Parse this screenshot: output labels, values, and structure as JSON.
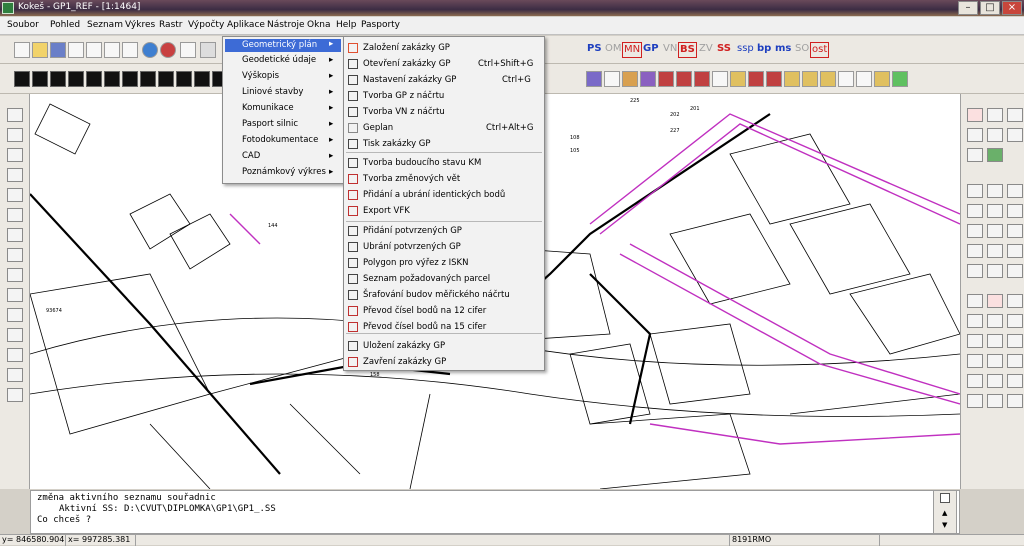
{
  "window": {
    "title": "Kokeš - GP1_REF - [1:1464]"
  },
  "menubar": [
    "Soubor",
    "Pohled",
    "Seznam",
    "Výkres",
    "Rastr",
    "Výpočty",
    "Aplikace",
    "Nástroje",
    "Okna",
    "Help",
    "Pasporty"
  ],
  "toolbar_ps": [
    {
      "label": "PS",
      "color": "#1e3fbf"
    },
    {
      "label": "OM",
      "color": "#a0a0a0"
    },
    {
      "label": "MN",
      "color": "#d02020"
    },
    {
      "label": "GP",
      "color": "#1e3fbf"
    },
    {
      "label": "VN",
      "color": "#a0a0a0"
    },
    {
      "label": "BS",
      "color": "#d02020"
    },
    {
      "label": "ZV",
      "color": "#a0a0a0"
    },
    {
      "label": "SS",
      "color": "#d02020"
    },
    {
      "label": "ssp",
      "color": "#1e3fbf"
    },
    {
      "label": "bp",
      "color": "#1e3fbf"
    },
    {
      "label": "ms",
      "color": "#1e3fbf"
    },
    {
      "label": "SO",
      "color": "#a0a0a0"
    },
    {
      "label": "ost",
      "color": "#d02020"
    }
  ],
  "aplikace_menu": [
    {
      "label": "Geometrický plán",
      "highlighted": true
    },
    {
      "label": "Geodetické údaje"
    },
    {
      "label": "Výškopis"
    },
    {
      "label": "Liniové stavby"
    },
    {
      "label": "Komunikace"
    },
    {
      "label": "Pasport silnic"
    },
    {
      "label": "Fotodokumentace"
    },
    {
      "label": "CAD"
    },
    {
      "label": "Poznámkový výkres"
    }
  ],
  "gp_submenu": [
    {
      "label": "Založení zakázky GP",
      "shortcut": "",
      "icon": "new-order-icon",
      "group": 1
    },
    {
      "label": "Otevření zakázky GP",
      "shortcut": "Ctrl+Shift+G",
      "icon": "open-order-icon",
      "group": 1
    },
    {
      "label": "Nastavení zakázky GP",
      "shortcut": "Ctrl+G",
      "icon": "settings-order-icon",
      "group": 1
    },
    {
      "label": "Tvorba GP z náčrtu",
      "shortcut": "",
      "icon": "sketch-icon",
      "group": 1
    },
    {
      "label": "Tvorba VN z náčrtu",
      "shortcut": "",
      "icon": "sketch-icon",
      "group": 1
    },
    {
      "label": "Geplan",
      "shortcut": "Ctrl+Alt+G",
      "icon": "geplan-icon",
      "group": 1
    },
    {
      "label": "Tisk zakázky GP",
      "shortcut": "",
      "icon": "print-icon",
      "group": 1
    },
    {
      "label": "Tvorba budoucího stavu KM",
      "shortcut": "",
      "icon": "map-icon",
      "group": 2
    },
    {
      "label": "Tvorba změnových vět",
      "shortcut": "",
      "icon": "change-icon",
      "group": 2
    },
    {
      "label": "Přidání a ubrání identických bodů",
      "shortcut": "",
      "icon": "points-icon",
      "group": 2
    },
    {
      "label": "Export VFK",
      "shortcut": "",
      "icon": "vfk-icon",
      "group": 2
    },
    {
      "label": "Přidání potvrzených GP",
      "shortcut": "",
      "icon": "add-doc-icon",
      "group": 3
    },
    {
      "label": "Ubrání potvrzených GP",
      "shortcut": "",
      "icon": "remove-doc-icon",
      "group": 3
    },
    {
      "label": "Polygon pro výřez z ISKN",
      "shortcut": "",
      "icon": "polygon-icon",
      "group": 3
    },
    {
      "label": "Seznam požadovaných parcel",
      "shortcut": "",
      "icon": "list-icon",
      "group": 3
    },
    {
      "label": "Šrafování budov měřického náčrtu",
      "shortcut": "",
      "icon": "hatch-icon",
      "group": 3
    },
    {
      "label": "Převod čísel bodů na 12 cifer",
      "shortcut": "",
      "icon": "convert12-icon",
      "group": 3
    },
    {
      "label": "Převod čísel bodů na 15 cifer",
      "shortcut": "",
      "icon": "convert15-icon",
      "group": 3
    },
    {
      "label": "Uložení zakázky GP",
      "shortcut": "",
      "icon": "save-icon",
      "group": 4
    },
    {
      "label": "Zavření zakázky GP",
      "shortcut": "",
      "icon": "close-order-icon",
      "group": 4
    }
  ],
  "command": {
    "line1": "změna aktivního seznamu souřadnic",
    "line2": "Aktivní SS: D:\\CVUT\\DIPLOMKA\\GP1\\GP1_.SS",
    "line3": "Co chceš ?"
  },
  "status": {
    "y": "y= 846580.904",
    "x": "x= 997285.381",
    "rmo": "8191RMO"
  },
  "map_labels": [
    "225",
    "202",
    "227",
    "201",
    "108",
    "105",
    "144",
    "158",
    "93674"
  ]
}
